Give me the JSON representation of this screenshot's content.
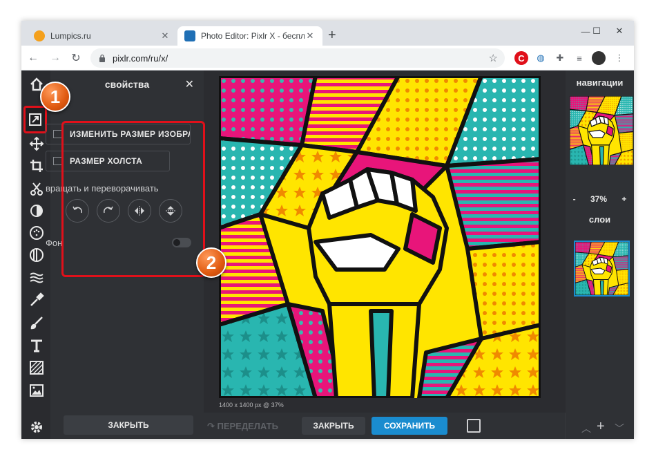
{
  "browser": {
    "tabs": [
      {
        "title": "Lumpics.ru",
        "favicon_color": "#f4a01c"
      },
      {
        "title": "Photo Editor: Pixlr X - бесплатны",
        "favicon_color": "#1f6fb5"
      }
    ],
    "url": "pixlr.com/ru/x/",
    "window_controls": [
      "minimize-icon",
      "maximize-icon",
      "close-icon"
    ]
  },
  "app": {
    "properties_panel": {
      "title": "свойства",
      "resize_image_label": "ИЗМЕНИТЬ РАЗМЕР ИЗОБРАЖ",
      "canvas_size_label": "РАЗМЕР ХОЛСТА",
      "rotate_section_label": "вращать и переворачивать",
      "background_label": "Фон",
      "background_enabled": false,
      "close_label": "ЗАКРЫТЬ"
    },
    "tools": [
      "home-icon",
      "arrange-icon",
      "move-icon",
      "crop-icon",
      "cutout-icon",
      "adjust-icon",
      "filter-icon",
      "effect-icon",
      "liquify-icon",
      "retouch-icon",
      "draw-icon",
      "text-icon",
      "pattern-icon",
      "image-icon",
      "settings-icon"
    ],
    "canvas": {
      "info": "1400 x 1400 px @ 37%"
    },
    "bottom_bar": {
      "redo_label": "ПЕРЕДЕЛАТЬ",
      "close_label": "ЗАКРЫТЬ",
      "save_label": "СОХРАНИТЬ"
    },
    "right_panel": {
      "navigation_title": "навигации",
      "zoom_value": "37%",
      "zoom_minus": "-",
      "zoom_plus": "+",
      "layers_title": "слои"
    }
  },
  "annotations": {
    "badge_1": "1",
    "badge_2": "2"
  },
  "colors": {
    "accent_blue": "#1a8ccf",
    "highlight_red": "#e0101a",
    "badge_orange": "#e8651a"
  }
}
